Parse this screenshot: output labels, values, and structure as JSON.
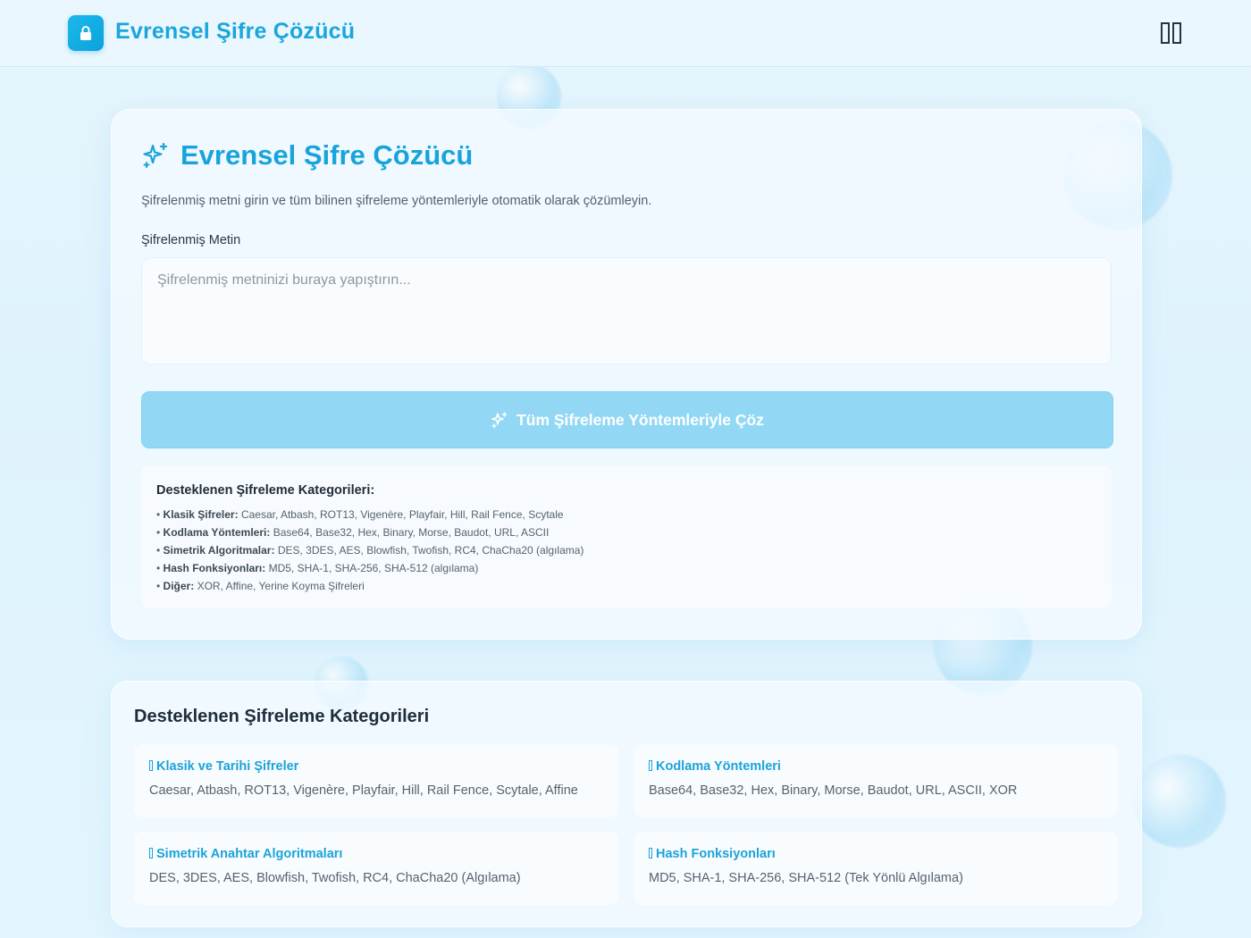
{
  "header": {
    "brand": "Evrensel Şifre Çözücü",
    "logo_icon": "lock-icon",
    "menu_icon": "menu-icon"
  },
  "main": {
    "title": "Evrensel Şifre Çözücü",
    "title_icon": "sparkles-icon",
    "description": "Şifrelenmiş metni girin ve tüm bilinen şifreleme yöntemleriyle otomatik olarak çözümleyin.",
    "input_label": "Şifrelenmiş Metin",
    "input_placeholder": "Şifrelenmiş metninizi buraya yapıştırın...",
    "input_value": "",
    "solve_button": "Tüm Şifreleme Yöntemleriyle Çöz",
    "info": {
      "title": "Desteklenen Şifreleme Kategorileri:",
      "items": [
        {
          "label": "Klasik Şifreler:",
          "text": "Caesar, Atbash, ROT13, Vigenère, Playfair, Hill, Rail Fence, Scytale"
        },
        {
          "label": "Kodlama Yöntemleri:",
          "text": "Base64, Base32, Hex, Binary, Morse, Baudot, URL, ASCII"
        },
        {
          "label": "Simetrik Algoritmalar:",
          "text": "DES, 3DES, AES, Blowfish, Twofish, RC4, ChaCha20 (algılama)"
        },
        {
          "label": "Hash Fonksiyonları:",
          "text": "MD5, SHA-1, SHA-256, SHA-512 (algılama)"
        },
        {
          "label": "Diğer:",
          "text": "XOR, Affine, Yerine Koyma Şifreleri"
        }
      ]
    }
  },
  "categories": {
    "title": "Desteklenen Şifreleme Kategorileri",
    "items": [
      {
        "title": "Klasik ve Tarihi Şifreler",
        "desc": "Caesar, Atbash, ROT13, Vigenère, Playfair, Hill, Rail Fence, Scytale, Affine"
      },
      {
        "title": "Kodlama Yöntemleri",
        "desc": "Base64, Base32, Hex, Binary, Morse, Baudot, URL, ASCII, XOR"
      },
      {
        "title": "Simetrik Anahtar Algoritmaları",
        "desc": "DES, 3DES, AES, Blowfish, Twofish, RC4, ChaCha20 (Algılama)"
      },
      {
        "title": "Hash Fonksiyonları",
        "desc": "MD5, SHA-1, SHA-256, SHA-512 (Tek Yönlü Algılama)"
      }
    ]
  },
  "colors": {
    "accent": "#1aa6dc",
    "button": "#92d8f4",
    "background": "#e2f4fd"
  }
}
